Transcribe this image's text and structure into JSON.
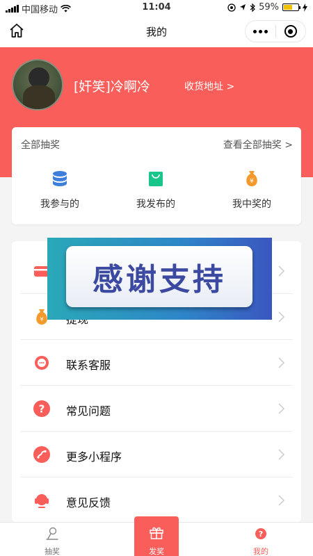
{
  "status_bar": {
    "carrier": "中国移动",
    "time": "11:04",
    "battery": "59%",
    "battery_level": 0.59
  },
  "nav": {
    "title": "我的",
    "home_icon": "home-icon",
    "more_icon": "more-dots-icon",
    "close_icon": "close-circle-icon"
  },
  "profile": {
    "username": "[奸笑]冷啊冷",
    "address_link": "收货地址 >"
  },
  "lottery": {
    "title": "全部抽奖",
    "view_all": "查看全部抽奖 >",
    "tabs": [
      {
        "label": "我参与的",
        "icon": "database-stack-icon",
        "color": "#3f7fdc"
      },
      {
        "label": "我发布的",
        "icon": "shopping-bag-icon",
        "color": "#19c68a"
      },
      {
        "label": "我中奖的",
        "icon": "money-bag-icon",
        "color": "#f49a2c"
      }
    ]
  },
  "menu": {
    "items": [
      {
        "label": "",
        "icon": "card-icon",
        "color": "#f95e5a"
      },
      {
        "label": "提现",
        "icon": "money-bag-icon",
        "color": "#f49a2c"
      },
      {
        "label": "联系客服",
        "icon": "chat-bubble-icon",
        "color": "#f95e5a"
      },
      {
        "label": "常见问题",
        "icon": "question-icon",
        "color": "#f95e5a"
      },
      {
        "label": "更多小程序",
        "icon": "link-icon",
        "color": "#f95e5a"
      },
      {
        "label": "意见反馈",
        "icon": "headset-icon",
        "color": "#f95e5a"
      }
    ]
  },
  "overlay": {
    "text": "感谢支持"
  },
  "tab_bar": {
    "items": [
      {
        "label": "抽奖",
        "icon": "lottery-icon"
      },
      {
        "label": "发奖",
        "icon": "gift-icon"
      },
      {
        "label": "我的",
        "icon": "question-badge-icon"
      }
    ]
  },
  "colors": {
    "brand": "#f95e5a",
    "background": "#f4f4f4",
    "overlay_text": "#3b4aa0"
  }
}
